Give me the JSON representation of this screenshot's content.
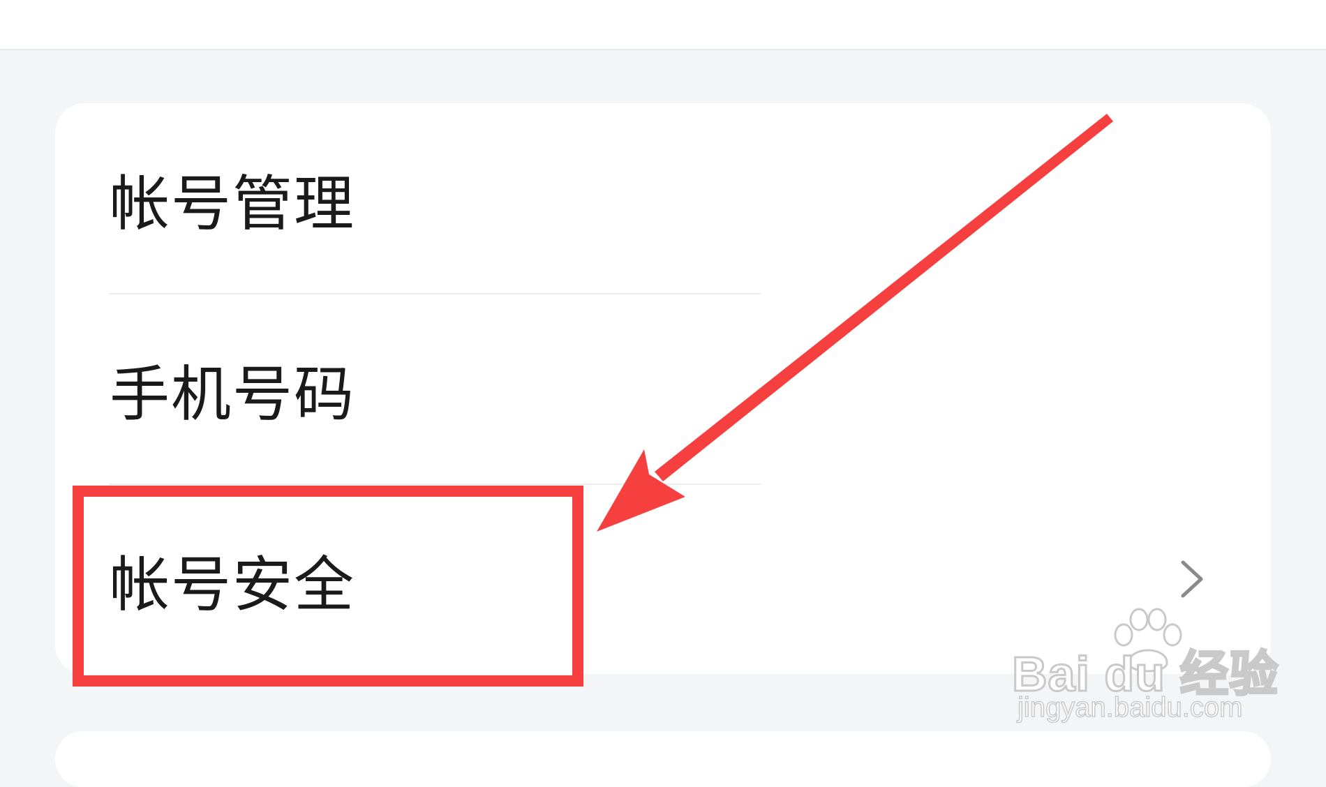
{
  "settings_list": {
    "items": [
      {
        "label": "帐号管理",
        "has_chevron": false
      },
      {
        "label": "手机号码",
        "has_chevron": false
      },
      {
        "label": "帐号安全",
        "has_chevron": true,
        "highlighted": true
      }
    ],
    "chevron_icon": "chevron-right-icon"
  },
  "annotation": {
    "arrow_color": "#f5403f",
    "highlight_color": "#f5403f"
  },
  "watermark": {
    "logo_text": "Bai du 经验",
    "url": "jingyan.baidu.com"
  }
}
